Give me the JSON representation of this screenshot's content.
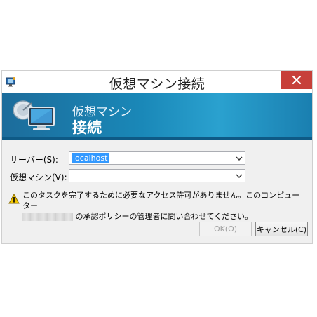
{
  "window": {
    "title": "仮想マシン接続",
    "close_glyph": "✕"
  },
  "banner": {
    "subtitle": "仮想マシン",
    "heading": "接続"
  },
  "form": {
    "server_label": "サーバー(S):",
    "server_value": "localhost",
    "vm_label": "仮想マシン(V):",
    "vm_value": ""
  },
  "warning": {
    "line1": "このタスクを完了するために必要なアクセス許可がありません。このコンピューター",
    "line2": "の承認ポリシーの管理者に問い合わせてください。"
  },
  "buttons": {
    "ok_label": "OK(O)",
    "cancel_label": "キャンセル(C)"
  },
  "colors": {
    "close_button": "#c7403a",
    "banner": "#1a88b8",
    "selection": "#3399ff"
  },
  "icons": [
    "app-icon",
    "close-icon",
    "monitor-satellite-icon",
    "dropdown-arrow-icon",
    "warning-icon"
  ]
}
